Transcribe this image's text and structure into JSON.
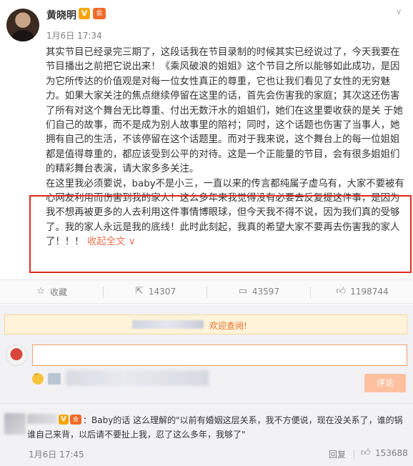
{
  "post": {
    "author": "黄晓明",
    "badge_v": "V",
    "badge_member": "会",
    "time": "1月6日 17:34",
    "menu_icon": "chevron-down-icon",
    "paragraph_1": "其实节目已经录完三期了，这段话我在节目录制的时候其实已经说过了，今天我要在节目播出之前把它说出来！《乘风破浪的姐姐》这个节目之所以能够如此成功，是因为它所传达的价值观是对每一位女性真正的尊重，它也让我们看见了女性的无穷魅力。如果大家关注的焦点继续停留在这里的话，首先会伤害我的家庭；其次这还伤害了所有对这个舞台无比尊重、付出无数汗水的姐姐们，她们在这里要收获的是关 于她们自己的故事，而不是成为别人故事里的陪衬；同时，这个话题也伤害了当事人，她拥有自己的生活，不该停留在这个话题里。而对于我来说，这个舞台上的每一位姐姐都是值得尊重的，都应该受到公平的对待。这是一个正能量的节目，会有很多姐姐们的精彩舞台表演，请大家多多关注。",
    "paragraph_2": "在这里我必须要说，baby不是小三，一直以来的传言都纯属子虚乌有，大家不要被有心网友利用而伤害到我的家人！这么多年来我觉得没有必要去反复提这件事，是因为我不想再被更多的人去利用这件事情博眼球，但今天我不得不说，因为我们真的受够了。我的家人永远是我的底线！此时此刻起，我真的希望大家不要再去伤害我的家人了！！！",
    "collapse_label": "收起全文 ∨"
  },
  "actions": {
    "favorite_label": "收藏",
    "repost_count": "14307",
    "comment_count": "43597",
    "like_count": "1198744"
  },
  "comment_box": {
    "notice_text": "欢迎查阅!",
    "submit_label": "评论"
  },
  "reply": {
    "badge_v": "V",
    "badge_member": "会",
    "text_line1": "：Baby的话 这么理解的\"以前有婚姻这层关系，我不方便说，现在没关系了，谁的锅",
    "text_line2": "谁自己来背，以后请不要扯上我，忍了这么多年，我够了\"",
    "time": "1月6日 17:45",
    "reply_label": "回复",
    "like_count": "153688"
  },
  "colors": {
    "accent": "#eb7350",
    "highlight_border": "#e02a20",
    "badge_v": "#f7a40a"
  }
}
